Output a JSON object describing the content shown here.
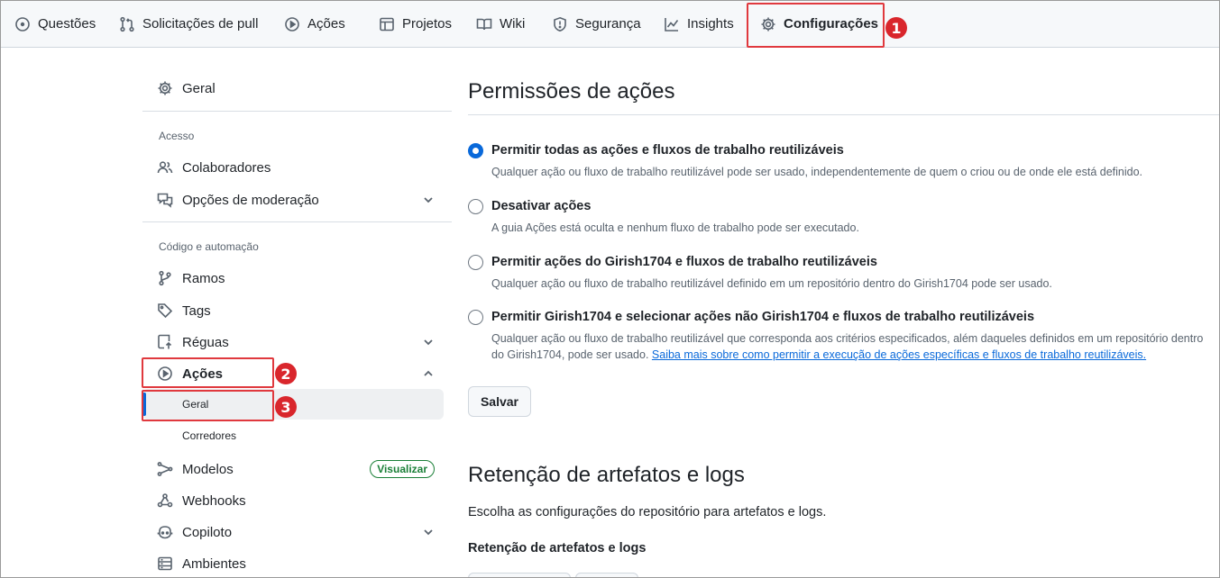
{
  "tabs": [
    {
      "label": "Questões",
      "icon": "issue-icon"
    },
    {
      "label": "Solicitações de pull",
      "icon": "pull-request-icon"
    },
    {
      "label": "Ações",
      "icon": "play-icon"
    },
    {
      "label": "Projetos",
      "icon": "table-icon"
    },
    {
      "label": "Wiki",
      "icon": "book-icon"
    },
    {
      "label": "Segurança",
      "icon": "shield-icon"
    },
    {
      "label": "Insights",
      "icon": "graph-icon"
    },
    {
      "label": "Configurações",
      "icon": "gear-icon",
      "active": true
    }
  ],
  "annotations": [
    "1",
    "2",
    "3"
  ],
  "sidebar": {
    "general": "Geral",
    "access_heading": "Acesso",
    "collaborators": "Colaboradores",
    "moderation": "Opções de moderação",
    "code_heading": "Código e automação",
    "branches": "Ramos",
    "tags": "Tags",
    "rules": "Réguas",
    "actions": "Ações",
    "actions_general": "Geral",
    "runners": "Corredores",
    "models": "Modelos",
    "models_badge": "Visualizar",
    "webhooks": "Webhooks",
    "copilot": "Copiloto",
    "environments": "Ambientes"
  },
  "main": {
    "permissions_title": "Permissões de ações",
    "options": [
      {
        "title": "Permitir todas as ações e fluxos de trabalho reutilizáveis",
        "desc": "Qualquer ação ou fluxo de trabalho reutilizável pode ser usado, independentemente de quem o criou ou de onde ele está definido.",
        "checked": true
      },
      {
        "title": "Desativar ações",
        "desc": "A guia Ações está oculta e nenhum fluxo de trabalho pode ser executado.",
        "checked": false
      },
      {
        "title": "Permitir ações do Girish1704 e fluxos de trabalho reutilizáveis",
        "desc": "Qualquer ação ou fluxo de trabalho reutilizável definido em um repositório dentro do Girish1704 pode ser usado.",
        "checked": false
      },
      {
        "title": "Permitir Girish1704 e selecionar ações não Girish1704 e fluxos de trabalho reutilizáveis",
        "desc": "Qualquer ação ou fluxo de trabalho reutilizável que corresponda aos critérios especificados, além daqueles definidos em um repositório dentro do Girish1704, pode ser usado.",
        "link": "Saiba mais sobre como permitir a execução de ações específicas e fluxos de trabalho reutilizáveis.",
        "checked": false
      }
    ],
    "save_label": "Salvar",
    "retention_title": "Retenção de artefatos e logs",
    "retention_desc": "Escolha as configurações do repositório para artefatos e logs.",
    "retention_label": "Retenção de artefatos e logs"
  },
  "colors": {
    "accent": "#0969da",
    "annotation": "#d9262c",
    "success": "#1a7f37"
  }
}
